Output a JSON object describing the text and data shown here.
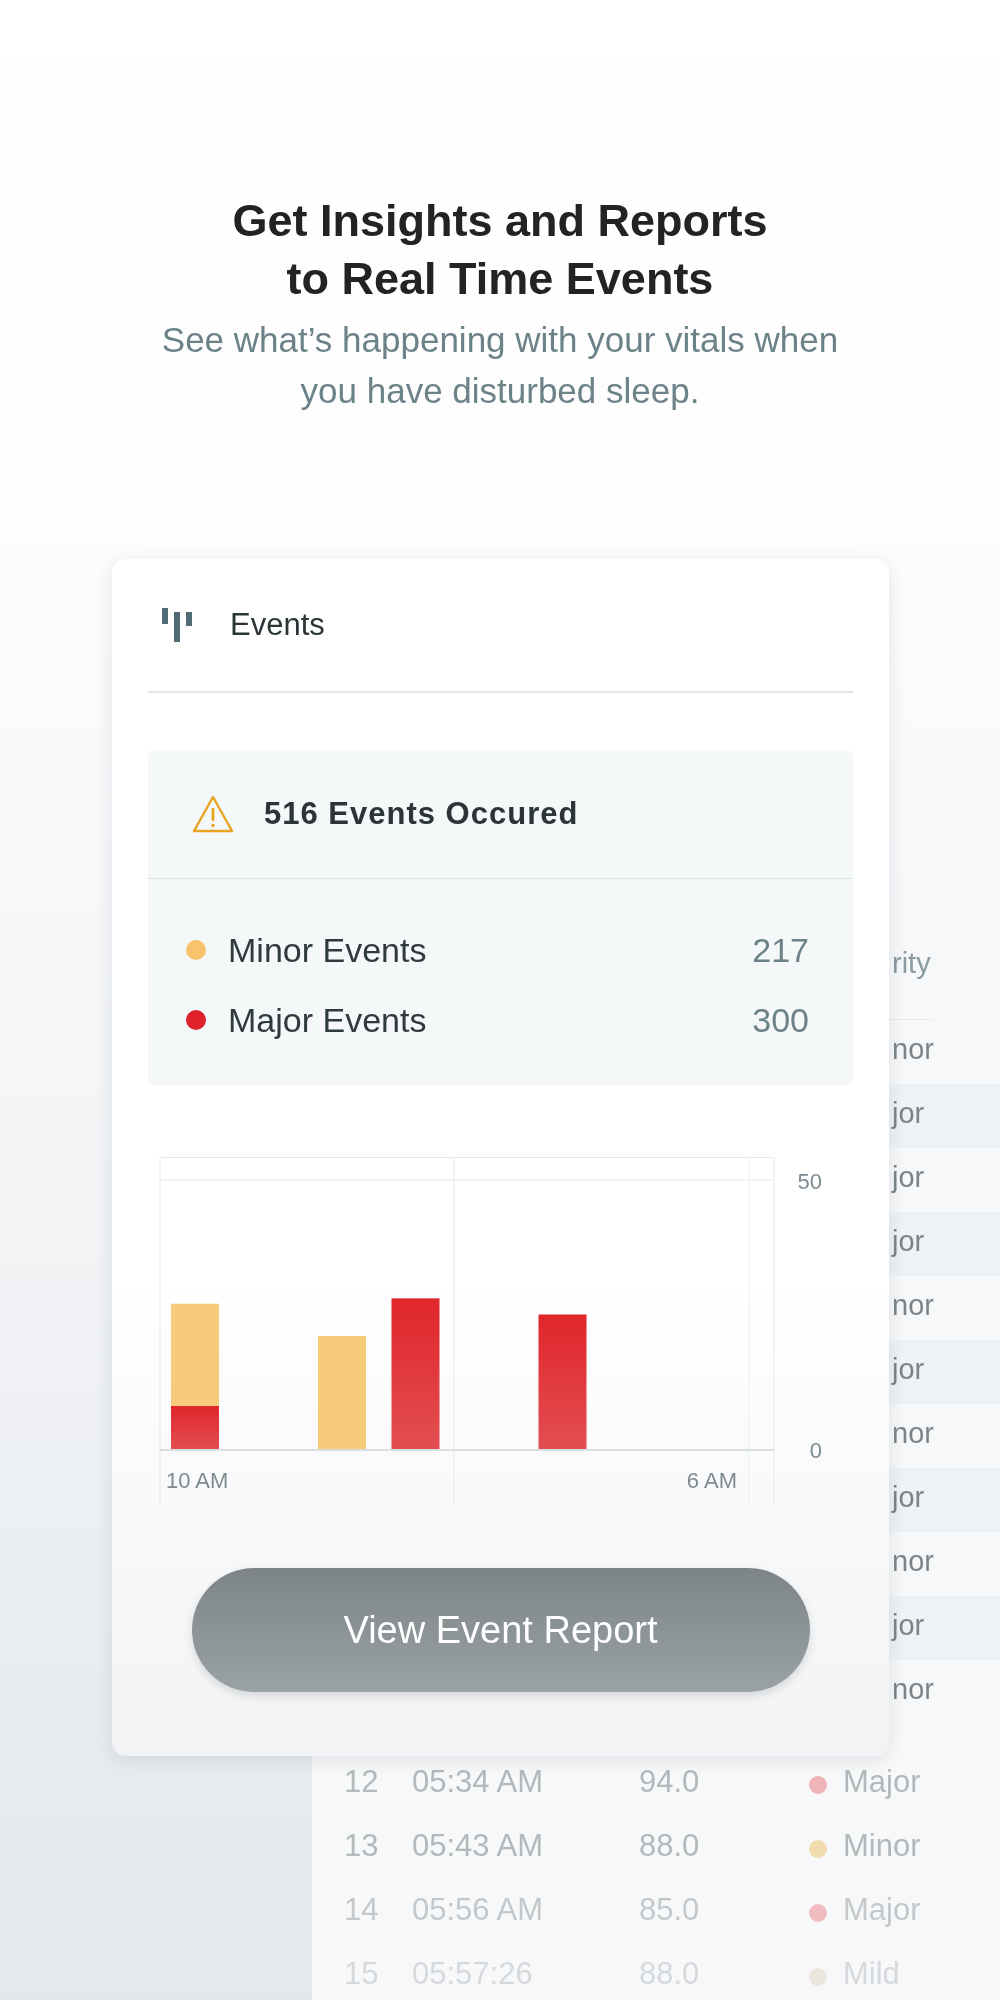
{
  "header": {
    "title_lines": [
      "Get Insights and Reports",
      "to Real Time Events"
    ],
    "subtitle": "See what’s happening with your vitals when you have disturbed sleep."
  },
  "background_table": {
    "header_fragment": "rity",
    "row_fragments": [
      "nor",
      "jor",
      "jor",
      "jor",
      "nor",
      "jor",
      "nor",
      "jor",
      "nor",
      "jor",
      "nor"
    ],
    "rows": [
      {
        "number": "12",
        "time": "05:34 AM",
        "value": "94.0",
        "severity": "Major",
        "color": "#f0b4b8"
      },
      {
        "number": "13",
        "time": "05:43 AM",
        "value": "88.0",
        "severity": "Minor",
        "color": "#f1dcae"
      },
      {
        "number": "14",
        "time": "05:56 AM",
        "value": "85.0",
        "severity": "Major",
        "color": "#f0bcc0"
      },
      {
        "number": "15",
        "time": "05:57:26",
        "value": "88.0",
        "severity": "Mild",
        "color": "#ebe6de"
      }
    ]
  },
  "card": {
    "title": "Events",
    "summary": {
      "heading": "516 Events Occured",
      "items": [
        {
          "label": "Minor Events",
          "count": "217",
          "color": "#f7c46c"
        },
        {
          "label": "Major Events",
          "count": "300",
          "color": "#e0222a"
        }
      ]
    },
    "chart_data": {
      "type": "bar",
      "stacked": true,
      "categories": [
        "10 AM",
        null,
        null,
        null,
        null,
        null,
        null,
        "6 AM"
      ],
      "series": [
        {
          "color": "#e0262b",
          "values": [
            8,
            null,
            null,
            28,
            null,
            25,
            null,
            null
          ]
        },
        {
          "color": "#f7cb7a",
          "values": [
            19,
            null,
            21,
            null,
            null,
            null,
            null,
            null
          ]
        }
      ],
      "ylim": [
        0,
        50
      ],
      "yticks": [
        0,
        50
      ]
    },
    "button": "View Event Report"
  }
}
